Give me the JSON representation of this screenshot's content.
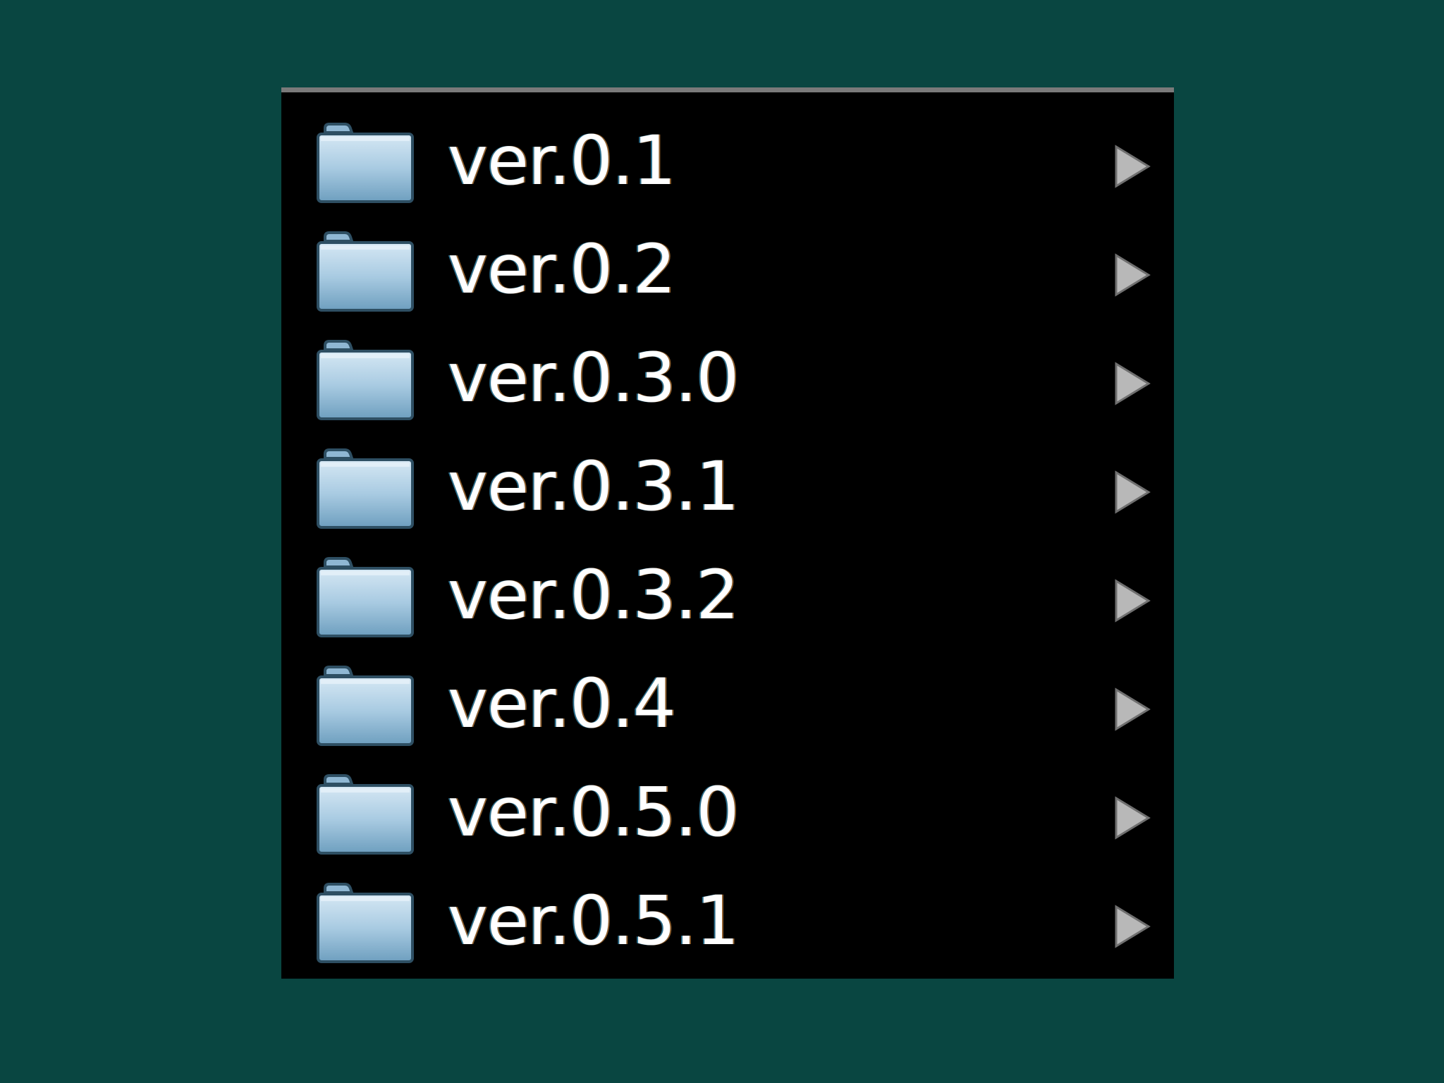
{
  "menu": {
    "items": [
      {
        "label": "ver.0.1",
        "icon": "folder-icon",
        "submenu_icon": "submenu-arrow-icon"
      },
      {
        "label": "ver.0.2",
        "icon": "folder-icon",
        "submenu_icon": "submenu-arrow-icon"
      },
      {
        "label": "ver.0.3.0",
        "icon": "folder-icon",
        "submenu_icon": "submenu-arrow-icon"
      },
      {
        "label": "ver.0.3.1",
        "icon": "folder-icon",
        "submenu_icon": "submenu-arrow-icon"
      },
      {
        "label": "ver.0.3.2",
        "icon": "folder-icon",
        "submenu_icon": "submenu-arrow-icon"
      },
      {
        "label": "ver.0.4",
        "icon": "folder-icon",
        "submenu_icon": "submenu-arrow-icon"
      },
      {
        "label": "ver.0.5.0",
        "icon": "folder-icon",
        "submenu_icon": "submenu-arrow-icon"
      },
      {
        "label": "ver.0.5.1",
        "icon": "folder-icon",
        "submenu_icon": "submenu-arrow-icon"
      }
    ]
  },
  "colors": {
    "desktop_background": "#094641",
    "menu_background": "#000000",
    "menu_border": "#7a7a7a",
    "text": "#ffffff",
    "folder_light": "#c3dced",
    "folder_dark": "#4a7f9e",
    "arrow": "#b8b8b8"
  }
}
